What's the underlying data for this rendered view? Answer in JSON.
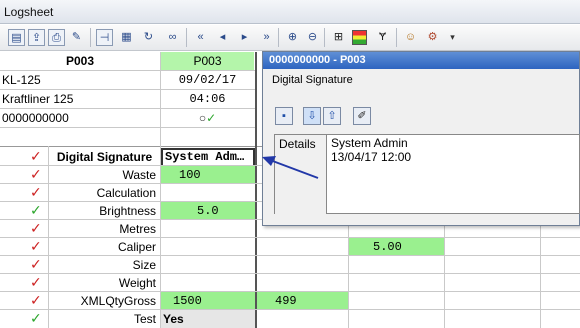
{
  "window": {
    "title": "Logsheet"
  },
  "toolbar": {
    "icons": [
      "new-icon",
      "export-icon",
      "print-icon",
      "edit-icon",
      "pin-icon",
      "grid-icon",
      "refresh-icon",
      "binoculars-icon",
      "first-icon",
      "prev-icon",
      "next-icon",
      "last-icon",
      "zoom-in-icon",
      "zoom-out-icon",
      "table-icon",
      "colors-icon",
      "signature-icon",
      "users-icon",
      "user-settings-icon",
      "dropdown-icon"
    ]
  },
  "header": {
    "col_title": "P003",
    "col2_title": "P003",
    "rows": [
      {
        "left": "KL-125",
        "value": "09/02/17"
      },
      {
        "left": "Kraftliner 125",
        "value": "04:06"
      },
      {
        "left": "0000000000",
        "value": "○✓"
      }
    ]
  },
  "rows": [
    {
      "status": "red",
      "label": "Digital Signature",
      "value": "System Adm…",
      "value2": "",
      "value3": ""
    },
    {
      "status": "red",
      "label": "Waste",
      "value": "100",
      "value2": "",
      "value3": ""
    },
    {
      "status": "red",
      "label": "Calculation",
      "value": "",
      "value2": "",
      "value3": ""
    },
    {
      "status": "green",
      "label": "Brightness",
      "value": "5.0",
      "value2": "",
      "value3": ""
    },
    {
      "status": "red",
      "label": "Metres",
      "value": "",
      "value2": "",
      "value3": ""
    },
    {
      "status": "red",
      "label": "Caliper",
      "value": "",
      "value2": "",
      "value3": "5.00"
    },
    {
      "status": "red",
      "label": "Size",
      "value": "",
      "value2": "",
      "value3": ""
    },
    {
      "status": "red",
      "label": "Weight",
      "value": "",
      "value2": "",
      "value3": ""
    },
    {
      "status": "red",
      "label": "XMLQtyGross",
      "value": "1500",
      "value2": "499",
      "value3": ""
    },
    {
      "status": "green",
      "label": "Test",
      "value": "Yes",
      "value2": "",
      "value3": ""
    }
  ],
  "dialog": {
    "title": "0000000000 - P003",
    "caption": "Digital Signature",
    "tab": "Details",
    "signer": "System Admin",
    "signed_at": "13/04/17 12:00",
    "buttons": [
      "save-icon",
      "down-arrow-icon",
      "up-arrow-icon",
      "sign-icon"
    ]
  },
  "colors": {
    "accent_green": "#9af08f",
    "check_red": "#cc1f1f",
    "check_green": "#2aa52a",
    "dialog_title": "#2d64c0",
    "annotation_arrow": "#2238a8"
  }
}
